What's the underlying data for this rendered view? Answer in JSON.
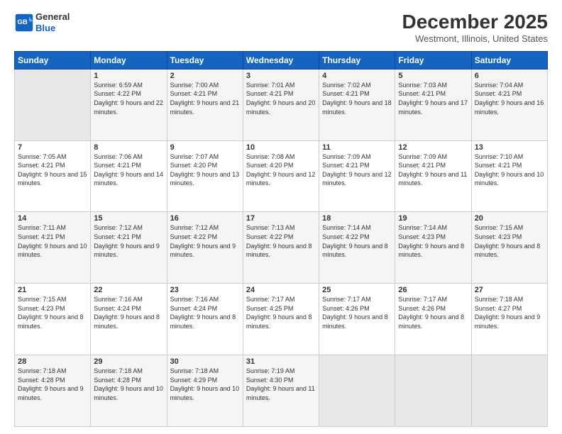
{
  "header": {
    "logo_line1": "General",
    "logo_line2": "Blue",
    "month": "December 2025",
    "location": "Westmont, Illinois, United States"
  },
  "weekdays": [
    "Sunday",
    "Monday",
    "Tuesday",
    "Wednesday",
    "Thursday",
    "Friday",
    "Saturday"
  ],
  "weeks": [
    [
      {
        "day": "",
        "sunrise": "",
        "sunset": "",
        "daylight": ""
      },
      {
        "day": "1",
        "sunrise": "Sunrise: 6:59 AM",
        "sunset": "Sunset: 4:22 PM",
        "daylight": "Daylight: 9 hours and 22 minutes."
      },
      {
        "day": "2",
        "sunrise": "Sunrise: 7:00 AM",
        "sunset": "Sunset: 4:21 PM",
        "daylight": "Daylight: 9 hours and 21 minutes."
      },
      {
        "day": "3",
        "sunrise": "Sunrise: 7:01 AM",
        "sunset": "Sunset: 4:21 PM",
        "daylight": "Daylight: 9 hours and 20 minutes."
      },
      {
        "day": "4",
        "sunrise": "Sunrise: 7:02 AM",
        "sunset": "Sunset: 4:21 PM",
        "daylight": "Daylight: 9 hours and 18 minutes."
      },
      {
        "day": "5",
        "sunrise": "Sunrise: 7:03 AM",
        "sunset": "Sunset: 4:21 PM",
        "daylight": "Daylight: 9 hours and 17 minutes."
      },
      {
        "day": "6",
        "sunrise": "Sunrise: 7:04 AM",
        "sunset": "Sunset: 4:21 PM",
        "daylight": "Daylight: 9 hours and 16 minutes."
      }
    ],
    [
      {
        "day": "7",
        "sunrise": "Sunrise: 7:05 AM",
        "sunset": "Sunset: 4:21 PM",
        "daylight": "Daylight: 9 hours and 15 minutes."
      },
      {
        "day": "8",
        "sunrise": "Sunrise: 7:06 AM",
        "sunset": "Sunset: 4:21 PM",
        "daylight": "Daylight: 9 hours and 14 minutes."
      },
      {
        "day": "9",
        "sunrise": "Sunrise: 7:07 AM",
        "sunset": "Sunset: 4:20 PM",
        "daylight": "Daylight: 9 hours and 13 minutes."
      },
      {
        "day": "10",
        "sunrise": "Sunrise: 7:08 AM",
        "sunset": "Sunset: 4:20 PM",
        "daylight": "Daylight: 9 hours and 12 minutes."
      },
      {
        "day": "11",
        "sunrise": "Sunrise: 7:09 AM",
        "sunset": "Sunset: 4:21 PM",
        "daylight": "Daylight: 9 hours and 12 minutes."
      },
      {
        "day": "12",
        "sunrise": "Sunrise: 7:09 AM",
        "sunset": "Sunset: 4:21 PM",
        "daylight": "Daylight: 9 hours and 11 minutes."
      },
      {
        "day": "13",
        "sunrise": "Sunrise: 7:10 AM",
        "sunset": "Sunset: 4:21 PM",
        "daylight": "Daylight: 9 hours and 10 minutes."
      }
    ],
    [
      {
        "day": "14",
        "sunrise": "Sunrise: 7:11 AM",
        "sunset": "Sunset: 4:21 PM",
        "daylight": "Daylight: 9 hours and 10 minutes."
      },
      {
        "day": "15",
        "sunrise": "Sunrise: 7:12 AM",
        "sunset": "Sunset: 4:21 PM",
        "daylight": "Daylight: 9 hours and 9 minutes."
      },
      {
        "day": "16",
        "sunrise": "Sunrise: 7:12 AM",
        "sunset": "Sunset: 4:22 PM",
        "daylight": "Daylight: 9 hours and 9 minutes."
      },
      {
        "day": "17",
        "sunrise": "Sunrise: 7:13 AM",
        "sunset": "Sunset: 4:22 PM",
        "daylight": "Daylight: 9 hours and 8 minutes."
      },
      {
        "day": "18",
        "sunrise": "Sunrise: 7:14 AM",
        "sunset": "Sunset: 4:22 PM",
        "daylight": "Daylight: 9 hours and 8 minutes."
      },
      {
        "day": "19",
        "sunrise": "Sunrise: 7:14 AM",
        "sunset": "Sunset: 4:23 PM",
        "daylight": "Daylight: 9 hours and 8 minutes."
      },
      {
        "day": "20",
        "sunrise": "Sunrise: 7:15 AM",
        "sunset": "Sunset: 4:23 PM",
        "daylight": "Daylight: 9 hours and 8 minutes."
      }
    ],
    [
      {
        "day": "21",
        "sunrise": "Sunrise: 7:15 AM",
        "sunset": "Sunset: 4:23 PM",
        "daylight": "Daylight: 9 hours and 8 minutes."
      },
      {
        "day": "22",
        "sunrise": "Sunrise: 7:16 AM",
        "sunset": "Sunset: 4:24 PM",
        "daylight": "Daylight: 9 hours and 8 minutes."
      },
      {
        "day": "23",
        "sunrise": "Sunrise: 7:16 AM",
        "sunset": "Sunset: 4:24 PM",
        "daylight": "Daylight: 9 hours and 8 minutes."
      },
      {
        "day": "24",
        "sunrise": "Sunrise: 7:17 AM",
        "sunset": "Sunset: 4:25 PM",
        "daylight": "Daylight: 9 hours and 8 minutes."
      },
      {
        "day": "25",
        "sunrise": "Sunrise: 7:17 AM",
        "sunset": "Sunset: 4:26 PM",
        "daylight": "Daylight: 9 hours and 8 minutes."
      },
      {
        "day": "26",
        "sunrise": "Sunrise: 7:17 AM",
        "sunset": "Sunset: 4:26 PM",
        "daylight": "Daylight: 9 hours and 8 minutes."
      },
      {
        "day": "27",
        "sunrise": "Sunrise: 7:18 AM",
        "sunset": "Sunset: 4:27 PM",
        "daylight": "Daylight: 9 hours and 9 minutes."
      }
    ],
    [
      {
        "day": "28",
        "sunrise": "Sunrise: 7:18 AM",
        "sunset": "Sunset: 4:28 PM",
        "daylight": "Daylight: 9 hours and 9 minutes."
      },
      {
        "day": "29",
        "sunrise": "Sunrise: 7:18 AM",
        "sunset": "Sunset: 4:28 PM",
        "daylight": "Daylight: 9 hours and 10 minutes."
      },
      {
        "day": "30",
        "sunrise": "Sunrise: 7:18 AM",
        "sunset": "Sunset: 4:29 PM",
        "daylight": "Daylight: 9 hours and 10 minutes."
      },
      {
        "day": "31",
        "sunrise": "Sunrise: 7:19 AM",
        "sunset": "Sunset: 4:30 PM",
        "daylight": "Daylight: 9 hours and 11 minutes."
      },
      {
        "day": "",
        "sunrise": "",
        "sunset": "",
        "daylight": ""
      },
      {
        "day": "",
        "sunrise": "",
        "sunset": "",
        "daylight": ""
      },
      {
        "day": "",
        "sunrise": "",
        "sunset": "",
        "daylight": ""
      }
    ]
  ]
}
